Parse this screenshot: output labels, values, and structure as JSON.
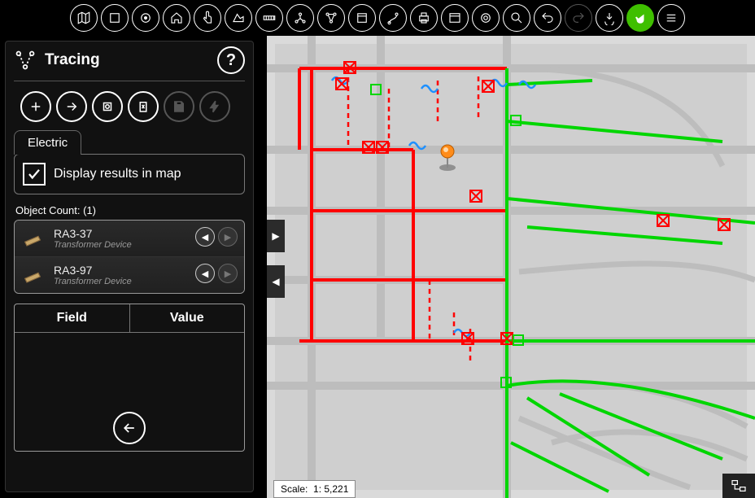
{
  "panel": {
    "title": "Tracing",
    "help_label": "?",
    "tab_label": "Electric",
    "display_checkbox_label": "Display results in map",
    "display_checked": true,
    "object_count_label": "Object Count:",
    "object_count_value": "(1)",
    "grid_headers": {
      "field": "Field",
      "value": "Value"
    },
    "results": [
      {
        "name": "RA3-37",
        "subtitle": "Transformer Device"
      },
      {
        "name": "RA3-97",
        "subtitle": "Transformer Device"
      }
    ]
  },
  "map": {
    "scale_label": "Scale:",
    "scale_value": "1: 5,221"
  },
  "toolbar": {
    "items": [
      "basemap",
      "layers",
      "overview",
      "home",
      "touch",
      "measure-area",
      "measure-ruler",
      "network-trace",
      "network-connected",
      "bookmark",
      "route",
      "print",
      "window",
      "search",
      "arrow-reply",
      "arrow-forward",
      "download",
      "pan-hand",
      "menu"
    ],
    "active_index": 17
  }
}
